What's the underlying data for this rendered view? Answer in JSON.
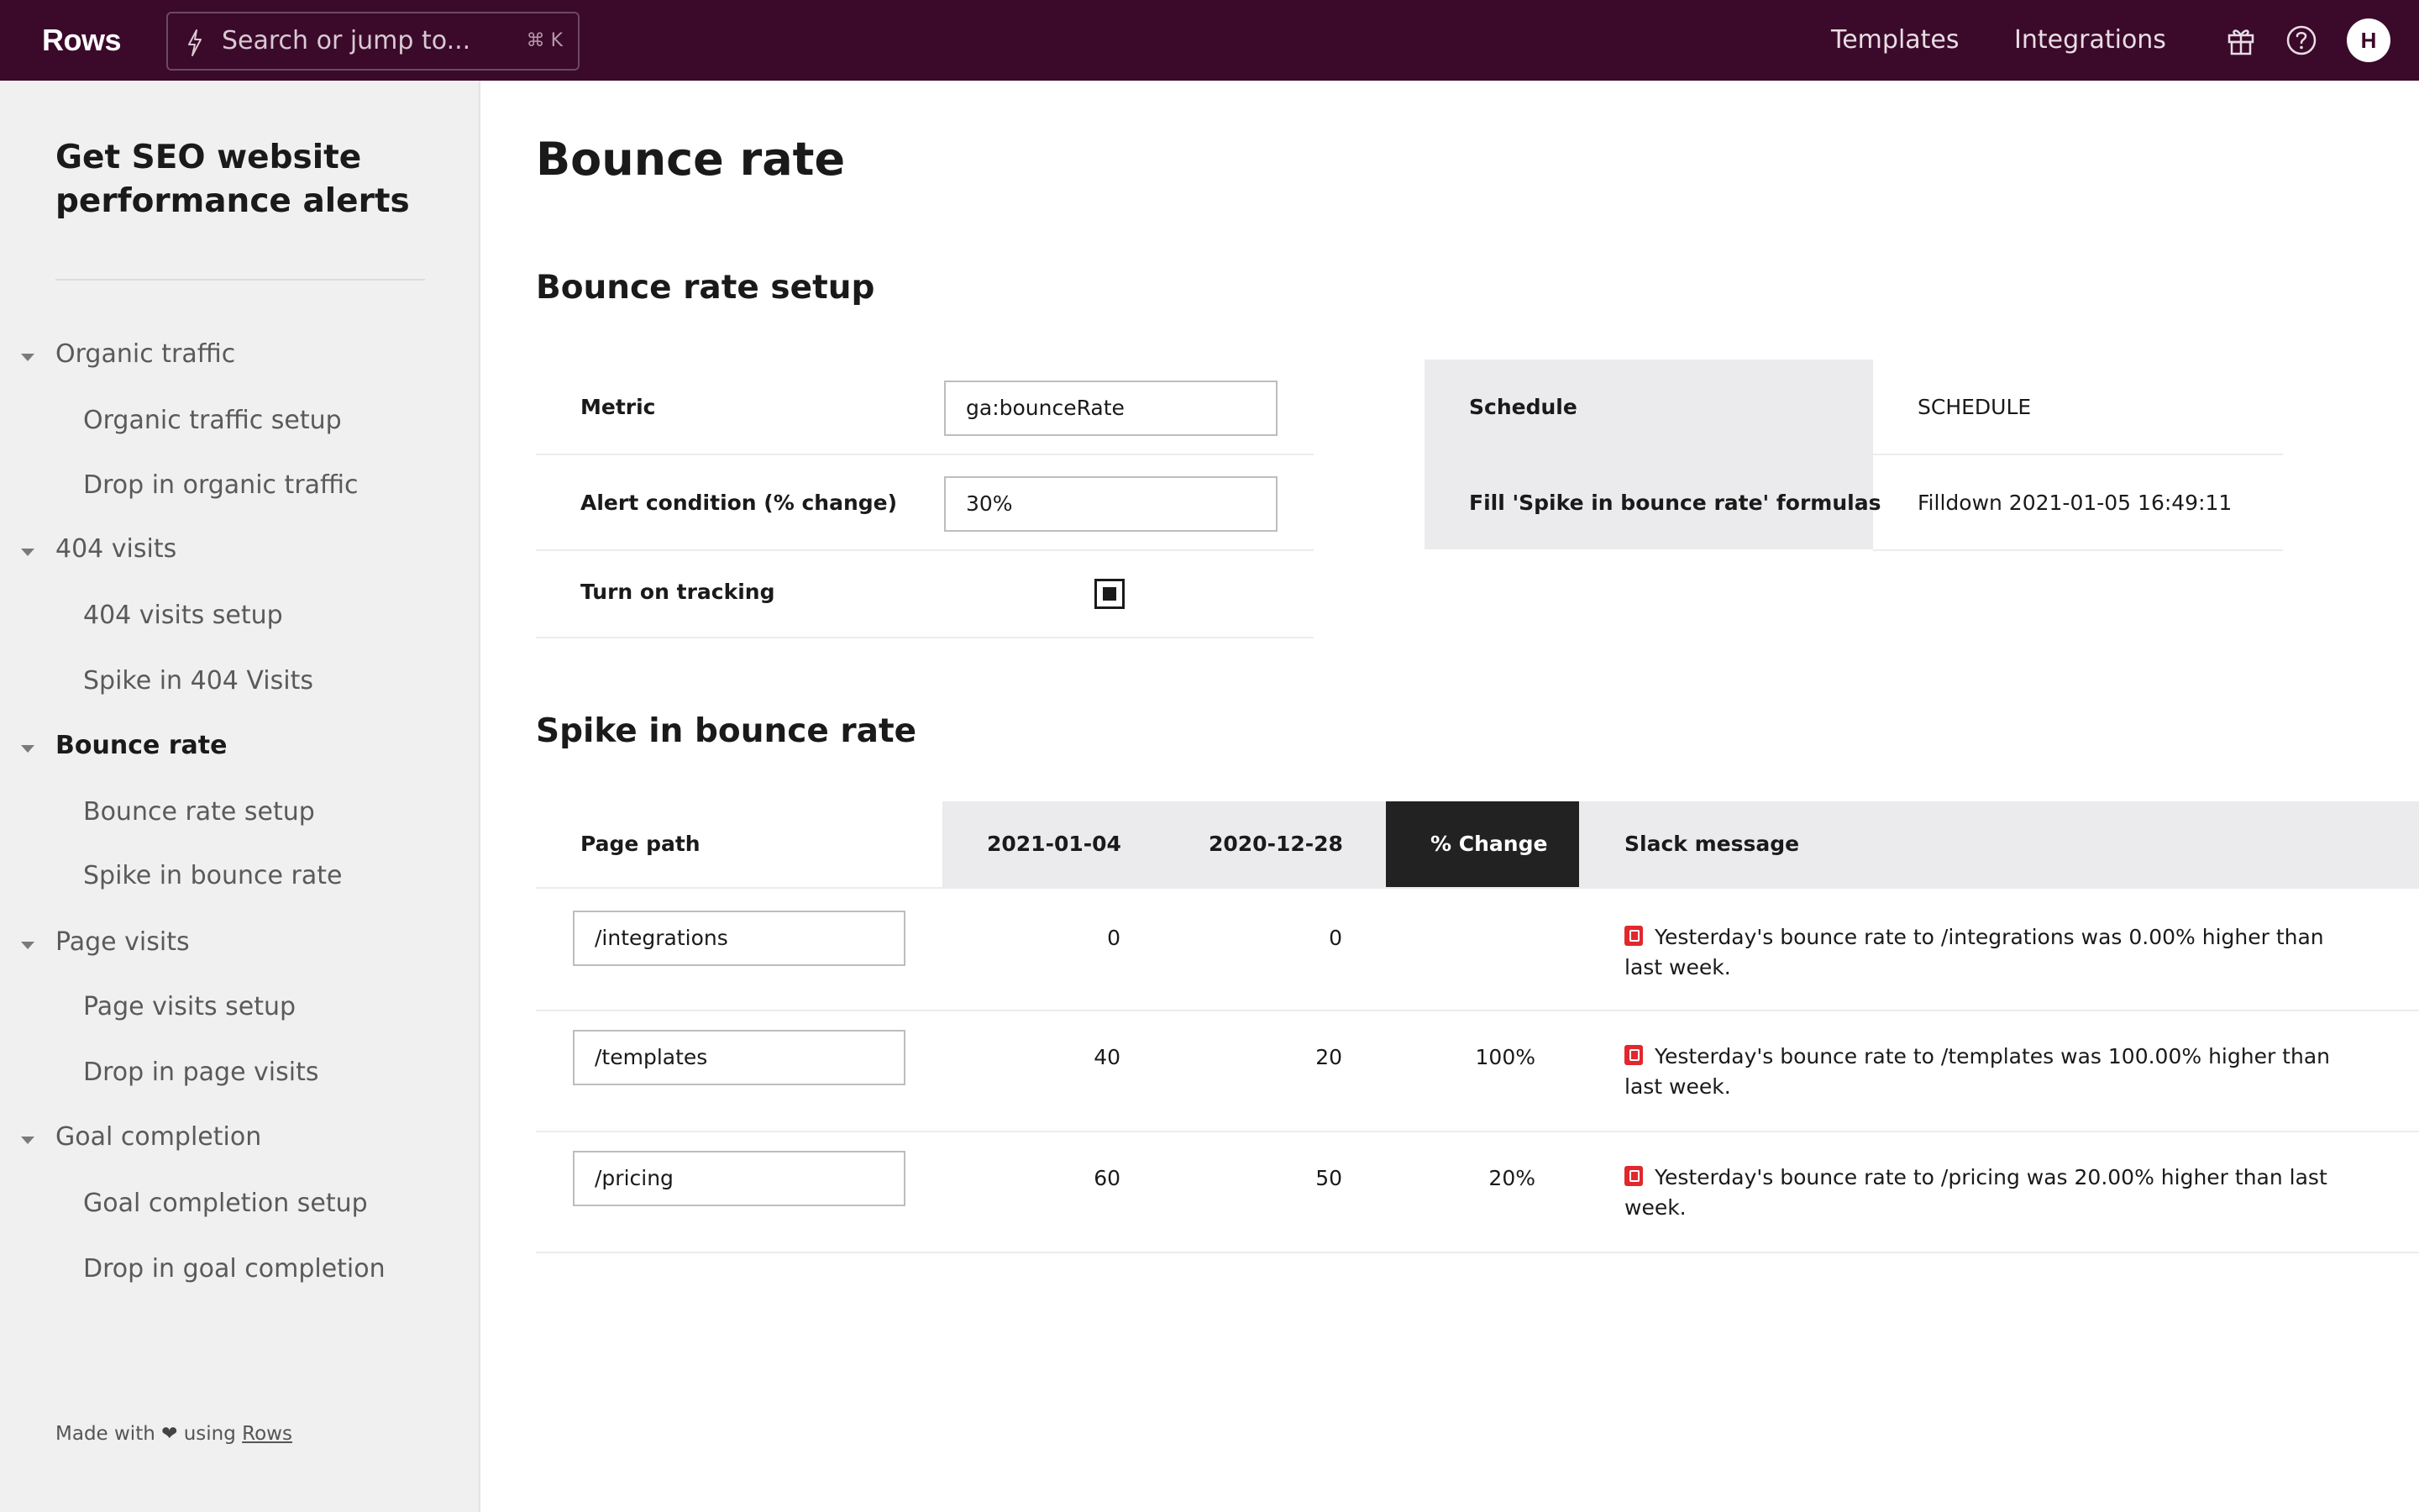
{
  "topbar": {
    "logo": "Rows",
    "search_placeholder": "Search or jump to...",
    "search_shortcut": "⌘ K",
    "nav": [
      "Templates",
      "Integrations"
    ],
    "avatar_initial": "H",
    "bg_color": "#3b0a2a"
  },
  "sidebar": {
    "title": "Get SEO website performance alerts",
    "sections": [
      {
        "label": "Organic traffic",
        "children": [
          "Organic traffic setup",
          "Drop in organic traffic"
        ]
      },
      {
        "label": "404 visits",
        "children": [
          "404 visits setup",
          "Spike in 404 Visits"
        ]
      },
      {
        "label": "Bounce rate",
        "children": [
          "Bounce rate setup",
          "Spike in bounce rate"
        ]
      },
      {
        "label": "Page visits",
        "children": [
          "Page visits setup",
          "Drop in page visits"
        ]
      },
      {
        "label": "Goal completion",
        "children": [
          "Goal completion setup",
          "Drop in goal completion"
        ]
      }
    ],
    "active_section": "Bounce rate",
    "footer": {
      "prefix": "Made with",
      "heart": "❤",
      "middle": "using",
      "link": "Rows"
    }
  },
  "main": {
    "title": "Bounce rate",
    "setup": {
      "title": "Bounce rate setup",
      "metric_label": "Metric",
      "metric_value": "ga:bounceRate",
      "alert_label": "Alert condition (% change)",
      "alert_value": "30%",
      "tracking_label": "Turn on tracking",
      "tracking_checked": true,
      "schedule_label": "Schedule",
      "schedule_value": "SCHEDULE",
      "fill_label": "Fill 'Spike in bounce rate' formulas",
      "fill_value": "Filldown 2021-01-05 16:49:11"
    },
    "spike": {
      "title": "Spike in bounce rate",
      "headers": [
        "Page path",
        "2021-01-04",
        "2020-12-28",
        "% Change",
        "Slack message"
      ],
      "rows": [
        {
          "path": "/integrations",
          "current": "0",
          "previous": "0",
          "change": "",
          "message": "Yesterday's bounce rate to /integrations was 0.00% higher than last week."
        },
        {
          "path": "/templates",
          "current": "40",
          "previous": "20",
          "change": "100%",
          "message": "Yesterday's bounce rate to /templates was 100.00% higher than last week."
        },
        {
          "path": "/pricing",
          "current": "60",
          "previous": "50",
          "change": "20%",
          "message": "Yesterday's bounce rate to /pricing was 20.00% higher than last week."
        }
      ]
    }
  }
}
